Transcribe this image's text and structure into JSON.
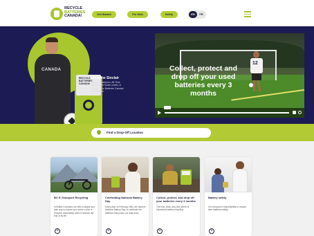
{
  "header": {
    "logo_lines": [
      "RECYCLE",
      "BATTERIES",
      "CANADA!"
    ],
    "nav": [
      {
        "label": "Get Started"
      },
      {
        "label": "For Kids"
      },
      {
        "label": "Safety"
      }
    ],
    "lang": {
      "en": "EN",
      "fr": "FR"
    }
  },
  "hero": {
    "hoodie_text": "CANADA",
    "bin_label": "RECYCLE BATTERIES CANADA!",
    "quote_name": "Christine Sinclair",
    "quote_desc": "Olympic Champion, All-Time International Goals Leader, & Recycle Your Batteries Canada! Ambassador",
    "video_caption": "Collect, protect and drop off your used batteries every 3 months",
    "jersey_number": "12"
  },
  "dropoff": {
    "label": "Find a Drop-Off Location"
  },
  "cards": [
    {
      "title": "BC E-Transport Recycling",
      "text": "In British Columbia, we offer a simple and safe way to ensure your entire e-bike is recycled responsibly when it reaches the end of its life."
    },
    {
      "title": "Celebrating National Battery Day",
      "text": "Every year on February 18th, we observe National Battery Day, to celebrate the batteries that power our daily lives."
    },
    {
      "title": "Collect, protect, and drop off your batteries every 3 months",
      "text": "The how, what, why and where of household battery recycling."
    },
    {
      "title": "Battery safety",
      "text": "It is everyone's responsibility to recycle their batteries safely."
    }
  ],
  "icons": {
    "card_button": "+",
    "location": "pin-icon",
    "menu": "hamburger-icon"
  },
  "colors": {
    "brand_green": "#a8c62e",
    "navy": "#1d1b54"
  }
}
